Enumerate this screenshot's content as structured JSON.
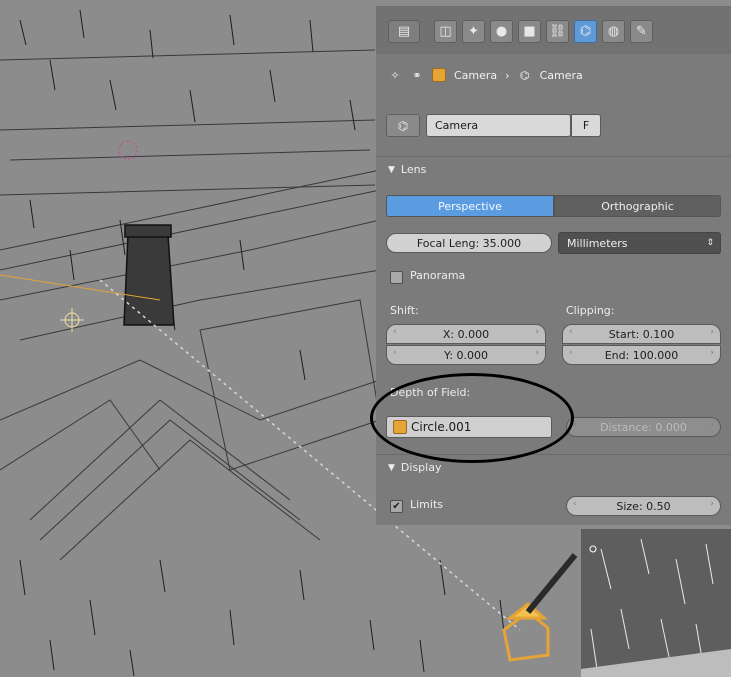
{
  "tabs": [
    {
      "icon": "render-icon"
    },
    {
      "icon": "scene-icon"
    },
    {
      "icon": "world-icon"
    },
    {
      "icon": "object-icon"
    },
    {
      "icon": "constraints-icon"
    },
    {
      "icon": "camera-data-icon",
      "active": true
    },
    {
      "icon": "material-icon"
    },
    {
      "icon": "physics-icon"
    }
  ],
  "breadcrumb": {
    "object": "Camera",
    "sep": "›",
    "data": "Camera"
  },
  "datablock": {
    "name": "Camera",
    "fake_user": "F"
  },
  "lens": {
    "section_label": "Lens",
    "projection": {
      "perspective": "Perspective",
      "orthographic": "Orthographic",
      "selected": "Perspective"
    },
    "focal_length": "Focal Leng: 35.000",
    "lens_unit": "Millimeters",
    "panorama_label": "Panorama",
    "shift_label": "Shift:",
    "shift_x": "X: 0.000",
    "shift_y": "Y: 0.000",
    "clipping_label": "Clipping:",
    "clip_start": "Start: 0.100",
    "clip_end": "End: 100.000"
  },
  "dof": {
    "label": "Depth of Field:",
    "object": "Circle.001",
    "distance": "Distance: 0.000"
  },
  "display": {
    "section_label": "Display",
    "limits_label": "Limits",
    "size": "Size: 0.50"
  },
  "colors": {
    "viewport_bg": "#8c8c8c",
    "panel_bg": "#7b7b7b",
    "active_blue": "#5b9be0",
    "selected_orange": "#e6a336"
  }
}
